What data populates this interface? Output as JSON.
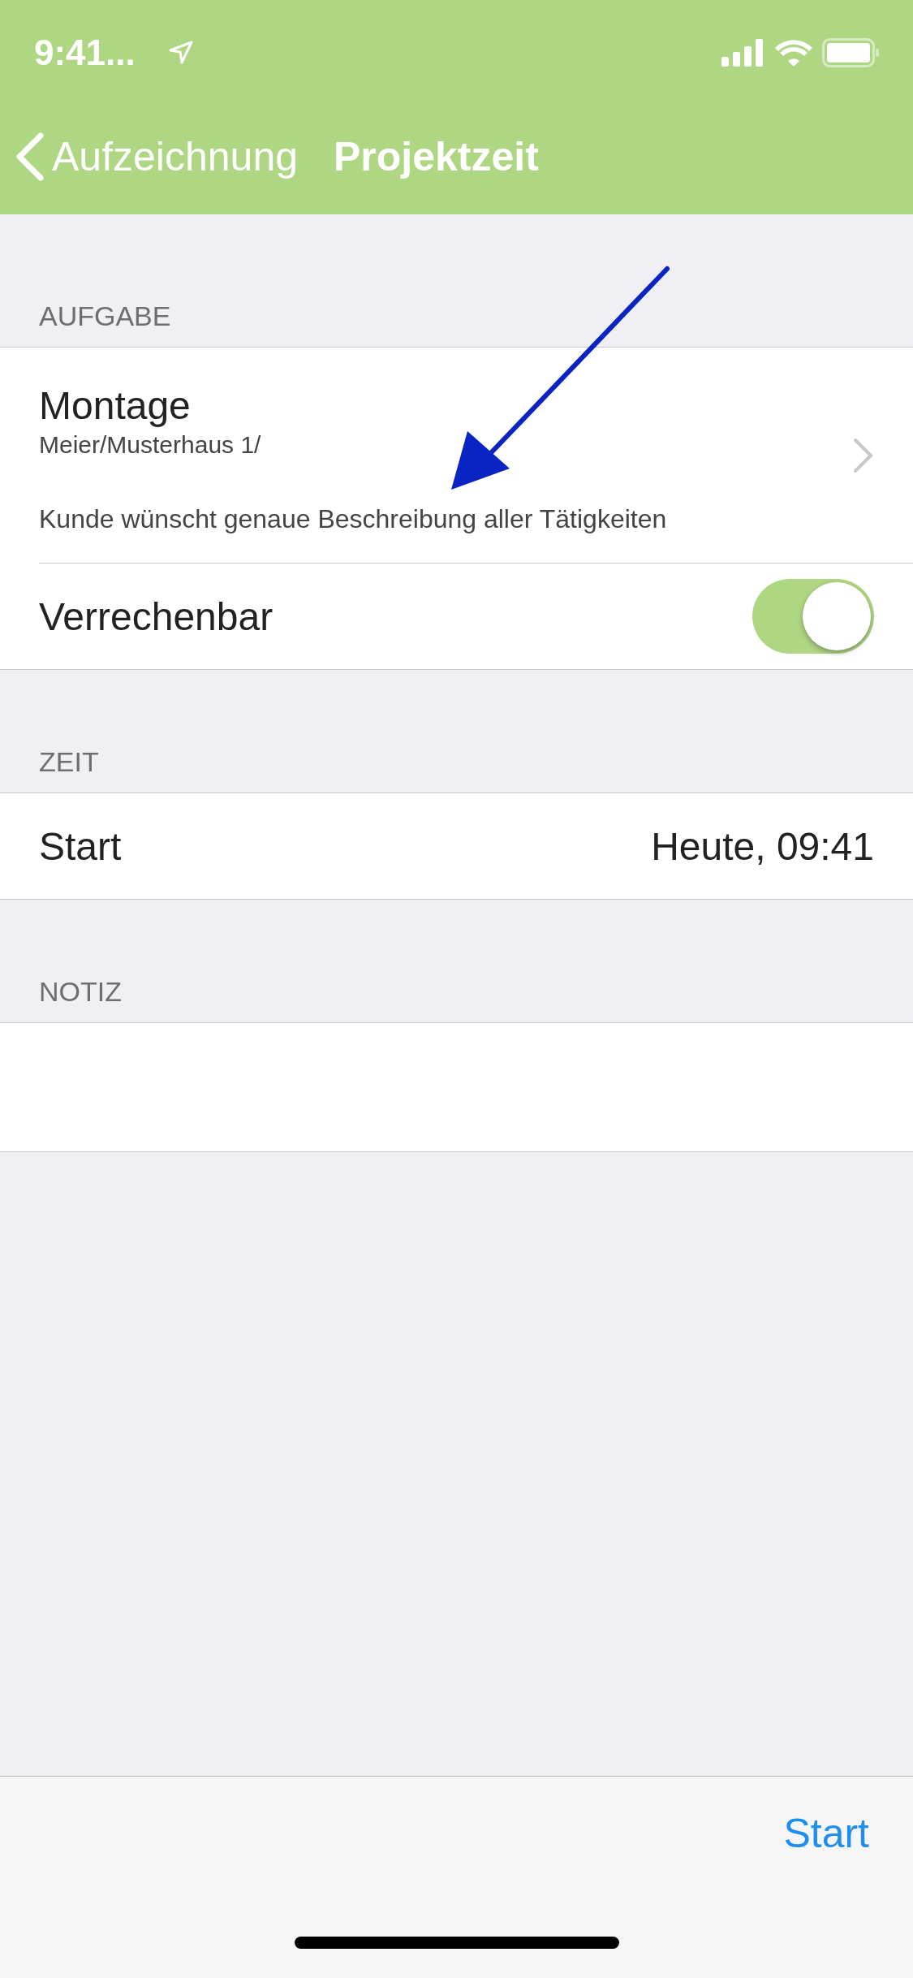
{
  "status_bar": {
    "time": "9:41..."
  },
  "nav_bar": {
    "back_label": "Aufzeichnung",
    "title": "Projektzeit"
  },
  "sections": [
    {
      "header": "AUFGABE",
      "rows": [
        {
          "kind": "task",
          "title": "Montage",
          "subtitle": "Meier/Musterhaus 1/",
          "description": "Kunde wünscht genaue Beschreibung aller Tätigkeiten"
        },
        {
          "kind": "toggle",
          "label": "Verrechenbar",
          "on": true
        }
      ]
    },
    {
      "header": "ZEIT",
      "rows": [
        {
          "kind": "value",
          "label": "Start",
          "value": "Heute, 09:41"
        }
      ]
    },
    {
      "header": "NOTIZ",
      "rows": [
        {
          "kind": "note"
        }
      ]
    }
  ],
  "toolbar": {
    "action": "Start"
  }
}
